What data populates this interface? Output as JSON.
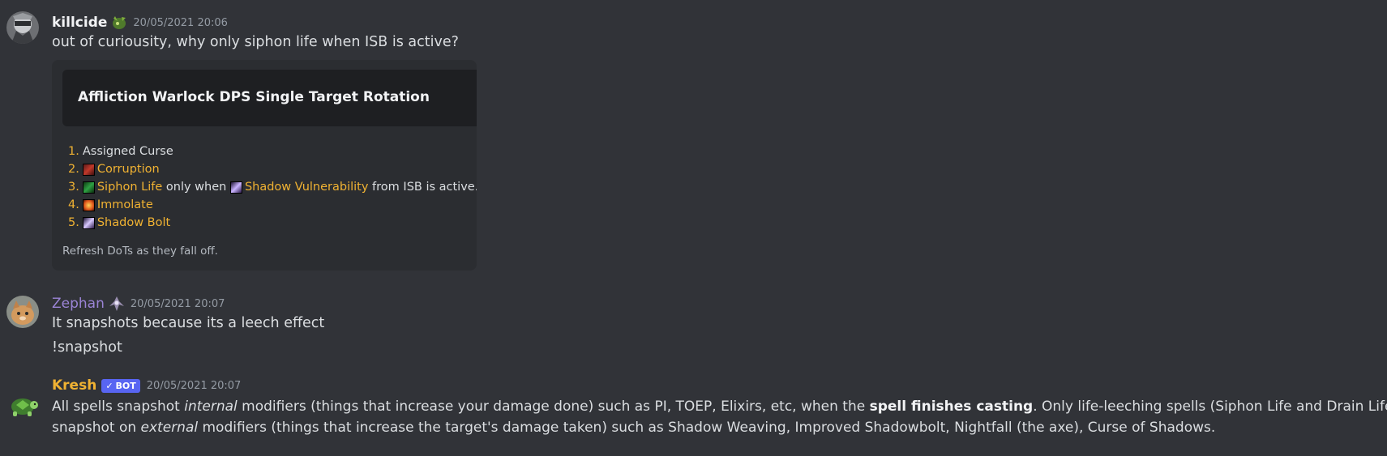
{
  "messages": [
    {
      "username": "killcide",
      "username_color": "#f2f3f5",
      "timestamp": "20/05/2021 20:06",
      "text": "out of curiousity, why only siphon life when ISB is active?",
      "embed": {
        "title": "Affliction Warlock DPS Single Target Rotation",
        "items": [
          {
            "num": "1.",
            "parts": [
              {
                "t": "Assigned Curse",
                "link": false
              }
            ]
          },
          {
            "num": "2.",
            "parts": [
              {
                "icon": "corruption-icon",
                "t": "Corruption",
                "link": true
              }
            ]
          },
          {
            "num": "3.",
            "parts": [
              {
                "icon": "siphon-life-icon",
                "t": "Siphon Life",
                "link": true
              },
              {
                "t": " only when ",
                "link": false
              },
              {
                "icon": "shadow-vulnerability-icon",
                "t": "Shadow Vulnerability",
                "link": true
              },
              {
                "t": " from ISB is active.",
                "link": false
              }
            ]
          },
          {
            "num": "4.",
            "parts": [
              {
                "icon": "immolate-icon",
                "t": "Immolate",
                "link": true
              }
            ]
          },
          {
            "num": "5.",
            "parts": [
              {
                "icon": "shadow-bolt-icon",
                "t": "Shadow Bolt",
                "link": true
              }
            ]
          }
        ],
        "footer": "Refresh DoTs as they fall off."
      }
    },
    {
      "username": "Zephan",
      "username_color": "#9b84d6",
      "timestamp": "20/05/2021 20:07",
      "lines": [
        "It snapshots because its a leech effect",
        "!snapshot"
      ]
    },
    {
      "username": "Kresh",
      "username_color": "#f0b232",
      "bot_tag": "BOT",
      "timestamp": "20/05/2021 20:07",
      "line1": {
        "a": "All spells snapshot ",
        "b_italic": "internal",
        "c": " modifiers (things that increase your damage done) such as PI, TOEP, Elixirs, etc, when the ",
        "d_bold": "spell finishes casting",
        "e": ". Only life-leeching spells (Siphon Life and Drain Life)"
      },
      "line2": {
        "a": "snapshot on ",
        "b_italic": "external",
        "c": " modifiers (things that increase the target's damage taken) such as Shadow Weaving, Improved Shadowbolt, Nightfall (the axe), Curse of Shadows."
      }
    }
  ],
  "colors": {
    "background": "#313338",
    "embed_bg": "#2b2d31",
    "link_gold": "#f0b232",
    "bot_badge": "#5865f2"
  }
}
